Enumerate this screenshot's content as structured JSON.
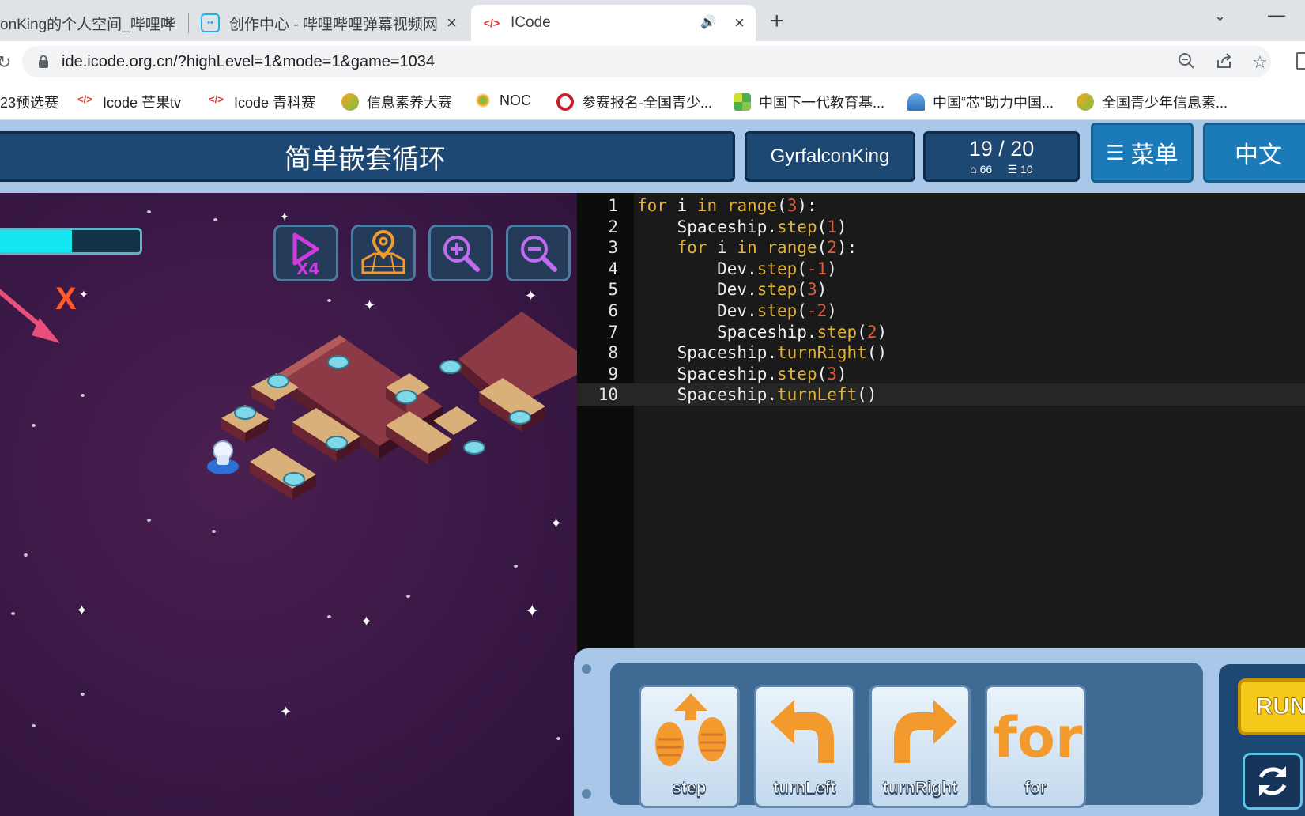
{
  "browser": {
    "tabs": [
      {
        "title": "onKing的个人空间_哔哩哔"
      },
      {
        "title": "创作中心 - 哔哩哔哩弹幕视频网"
      },
      {
        "title": "ICode"
      }
    ],
    "address_url": "ide.icode.org.cn/?highLevel=1&mode=1&game=1034",
    "bookmarks": [
      {
        "label": "23预选赛"
      },
      {
        "label": "Icode 芒果tv"
      },
      {
        "label": "Icode 青科赛"
      },
      {
        "label": "信息素养大赛"
      },
      {
        "label": "NOC"
      },
      {
        "label": "参赛报名-全国青少..."
      },
      {
        "label": "中国下一代教育基..."
      },
      {
        "label": "中国“芯”助力中国..."
      },
      {
        "label": "全国青少年信息素..."
      }
    ]
  },
  "header": {
    "level_title": "简单嵌套循环",
    "username": "GyrfalconKing",
    "progress": "19 / 20",
    "stat_energy": "66",
    "stat_lines": "10",
    "menu_label": "菜单",
    "language_label": "中文"
  },
  "game": {
    "energy_fraction": 0.52,
    "x_mark": "X"
  },
  "editor": {
    "lines": [
      {
        "num": "1",
        "text": "for i in range(3):"
      },
      {
        "num": "2",
        "text": "    Spaceship.step(1)"
      },
      {
        "num": "3",
        "text": "    for i in range(2):"
      },
      {
        "num": "4",
        "text": "        Dev.step(-1)"
      },
      {
        "num": "5",
        "text": "        Dev.step(3)"
      },
      {
        "num": "6",
        "text": "        Dev.step(-2)"
      },
      {
        "num": "7",
        "text": "        Spaceship.step(2)"
      },
      {
        "num": "8",
        "text": "    Spaceship.turnRight()"
      },
      {
        "num": "9",
        "text": "    Spaceship.step(3)"
      },
      {
        "num": "10",
        "text": "    Spaceship.turnLeft()"
      }
    ]
  },
  "blocks": [
    {
      "label": "step",
      "icon": "step-icon"
    },
    {
      "label": "turnLeft",
      "icon": "turn-left-icon"
    },
    {
      "label": "turnRight",
      "icon": "turn-right-icon"
    },
    {
      "label": "for",
      "icon": "for-icon"
    }
  ],
  "controls": {
    "run_label": "RUN"
  },
  "colors": {
    "accent_orange": "#f29a2e",
    "energy": "#16e5f2",
    "header_blue": "#1d4873"
  }
}
